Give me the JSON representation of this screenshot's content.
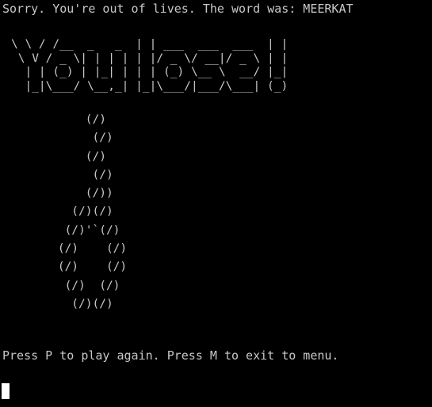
{
  "terminal": {
    "status_message": "Sorry. You're out of lives. The word was: MEERKAT",
    "banner_lines": [
      "\\ \\ / /__  _   _  | | ___  ___  ___  | |",
      " \\ V / _ \\| | | | | |/ _ \\/ __|/ _ \\ | |",
      "  | | (_) | |_| | | | (_) \\__ \\  __/ |_|",
      "  |_|\\___/ \\__,_| |_|\\___/|___/\\___| (_)"
    ],
    "noose_lines": [
      "            (/)",
      "             (/)",
      "            (/)",
      "             (/)",
      "            (/))",
      "          (/)(/)",
      "         (/)'`(/)",
      "        (/)    (/)",
      "        (/)    (/)",
      "         (/)  (/)",
      "          (/)(/)"
    ],
    "prompt_message": "Press P to play again. Press M to exit to menu."
  }
}
